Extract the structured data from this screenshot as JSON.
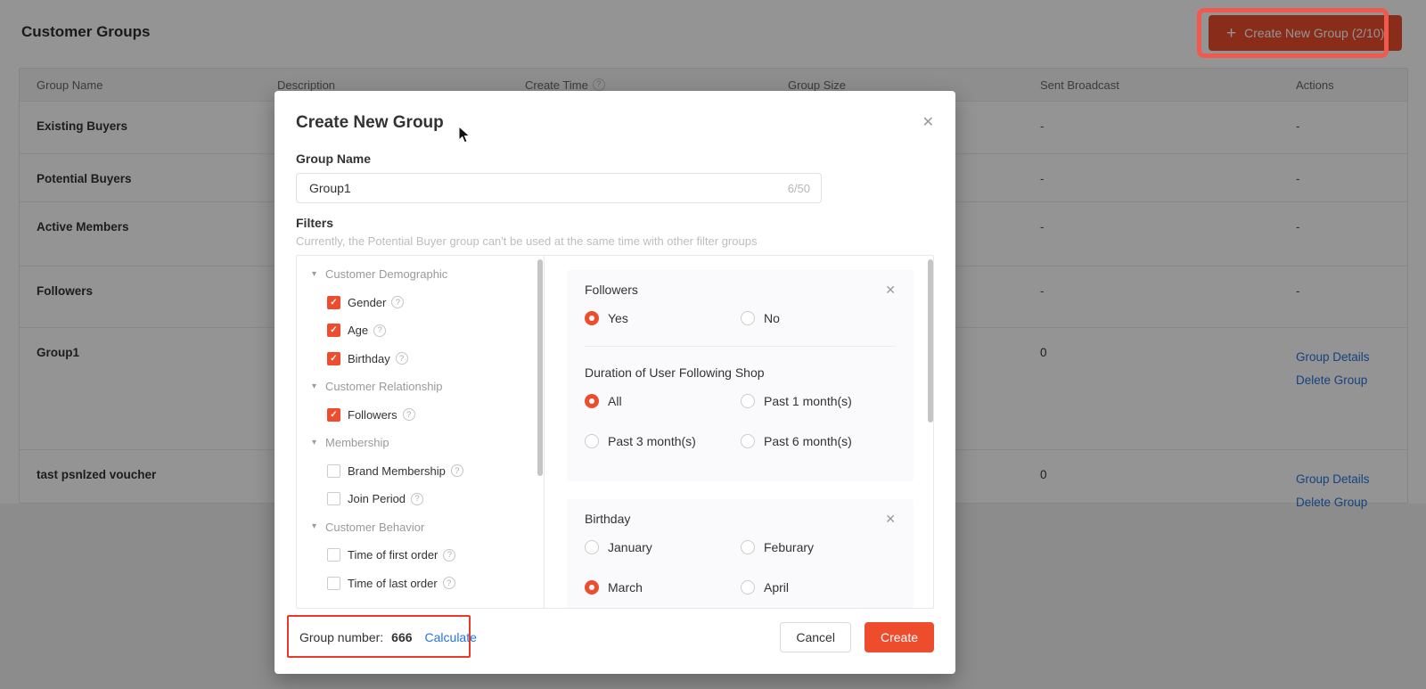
{
  "icons": {
    "plus": "+",
    "close": "✕",
    "help": "?",
    "caret": "▾",
    "check": "✓"
  },
  "colors": {
    "accent": "#ee4d2d",
    "link_blue": "#2673dd",
    "annotation_top": "#f0594d",
    "annotation_bottom": "#e63b2b",
    "overlay": "rgba(0,0,0,0.42)"
  },
  "page": {
    "title": "Customer Groups",
    "create_button_label": "Create New Group (2/10)",
    "table": {
      "columns": [
        "Group Name",
        "Description",
        "Create Time",
        "Group Size",
        "Sent Broadcast",
        "Actions"
      ],
      "rows": [
        {
          "name": "Existing Buyers",
          "sent_broadcast": "-",
          "action1": "-",
          "action2": ""
        },
        {
          "name": "Potential Buyers",
          "sent_broadcast": "-",
          "action1": "-",
          "action2": ""
        },
        {
          "name": "Active Members",
          "sent_broadcast": "-",
          "action1": "-",
          "action2": ""
        },
        {
          "name": "Followers",
          "sent_broadcast": "-",
          "action1": "-",
          "action2": ""
        },
        {
          "name": "Group1",
          "sent_broadcast": "0",
          "action1": "Group Details",
          "action2": "Delete Group"
        },
        {
          "name": "tast psnlzed voucher",
          "sent_broadcast": "0",
          "action1": "Group Details",
          "action2": "Delete Group"
        }
      ]
    }
  },
  "modal": {
    "title": "Create New Group",
    "group_name": {
      "label": "Group Name",
      "value": "Group1",
      "counter": "6/50"
    },
    "filters": {
      "label": "Filters",
      "note": "Currently, the Potential Buyer group can't be used at the same time with other filter groups",
      "tree": [
        {
          "type": "section",
          "label": "Customer Demographic"
        },
        {
          "type": "item",
          "label": "Gender",
          "checked": true
        },
        {
          "type": "item",
          "label": "Age",
          "checked": true
        },
        {
          "type": "item",
          "label": "Birthday",
          "checked": true
        },
        {
          "type": "section",
          "label": "Customer Relationship"
        },
        {
          "type": "item",
          "label": "Followers",
          "checked": true
        },
        {
          "type": "section",
          "label": "Membership"
        },
        {
          "type": "item",
          "label": "Brand Membership",
          "checked": false
        },
        {
          "type": "item",
          "label": "Join Period",
          "checked": false
        },
        {
          "type": "section",
          "label": "Customer Behavior"
        },
        {
          "type": "item",
          "label": "Time of first order",
          "checked": false
        },
        {
          "type": "item",
          "label": "Time of last order",
          "checked": false
        }
      ],
      "cards": [
        {
          "title": "Followers",
          "options": [
            {
              "label": "Yes",
              "selected": true
            },
            {
              "label": "No",
              "selected": false
            }
          ],
          "sub": {
            "title": "Duration of User Following Shop",
            "options": [
              {
                "label": "All",
                "selected": true
              },
              {
                "label": "Past 1 month(s)",
                "selected": false
              },
              {
                "label": "Past 3 month(s)",
                "selected": false
              },
              {
                "label": "Past 6 month(s)",
                "selected": false
              }
            ]
          }
        },
        {
          "title": "Birthday",
          "options": [
            {
              "label": "January",
              "selected": false
            },
            {
              "label": "Feburary",
              "selected": false
            },
            {
              "label": "March",
              "selected": true
            },
            {
              "label": "April",
              "selected": false
            }
          ]
        }
      ]
    },
    "footer": {
      "group_number_label": "Group number:",
      "group_number_value": "666",
      "calculate_label": "Calculate",
      "cancel_label": "Cancel",
      "create_label": "Create"
    }
  }
}
